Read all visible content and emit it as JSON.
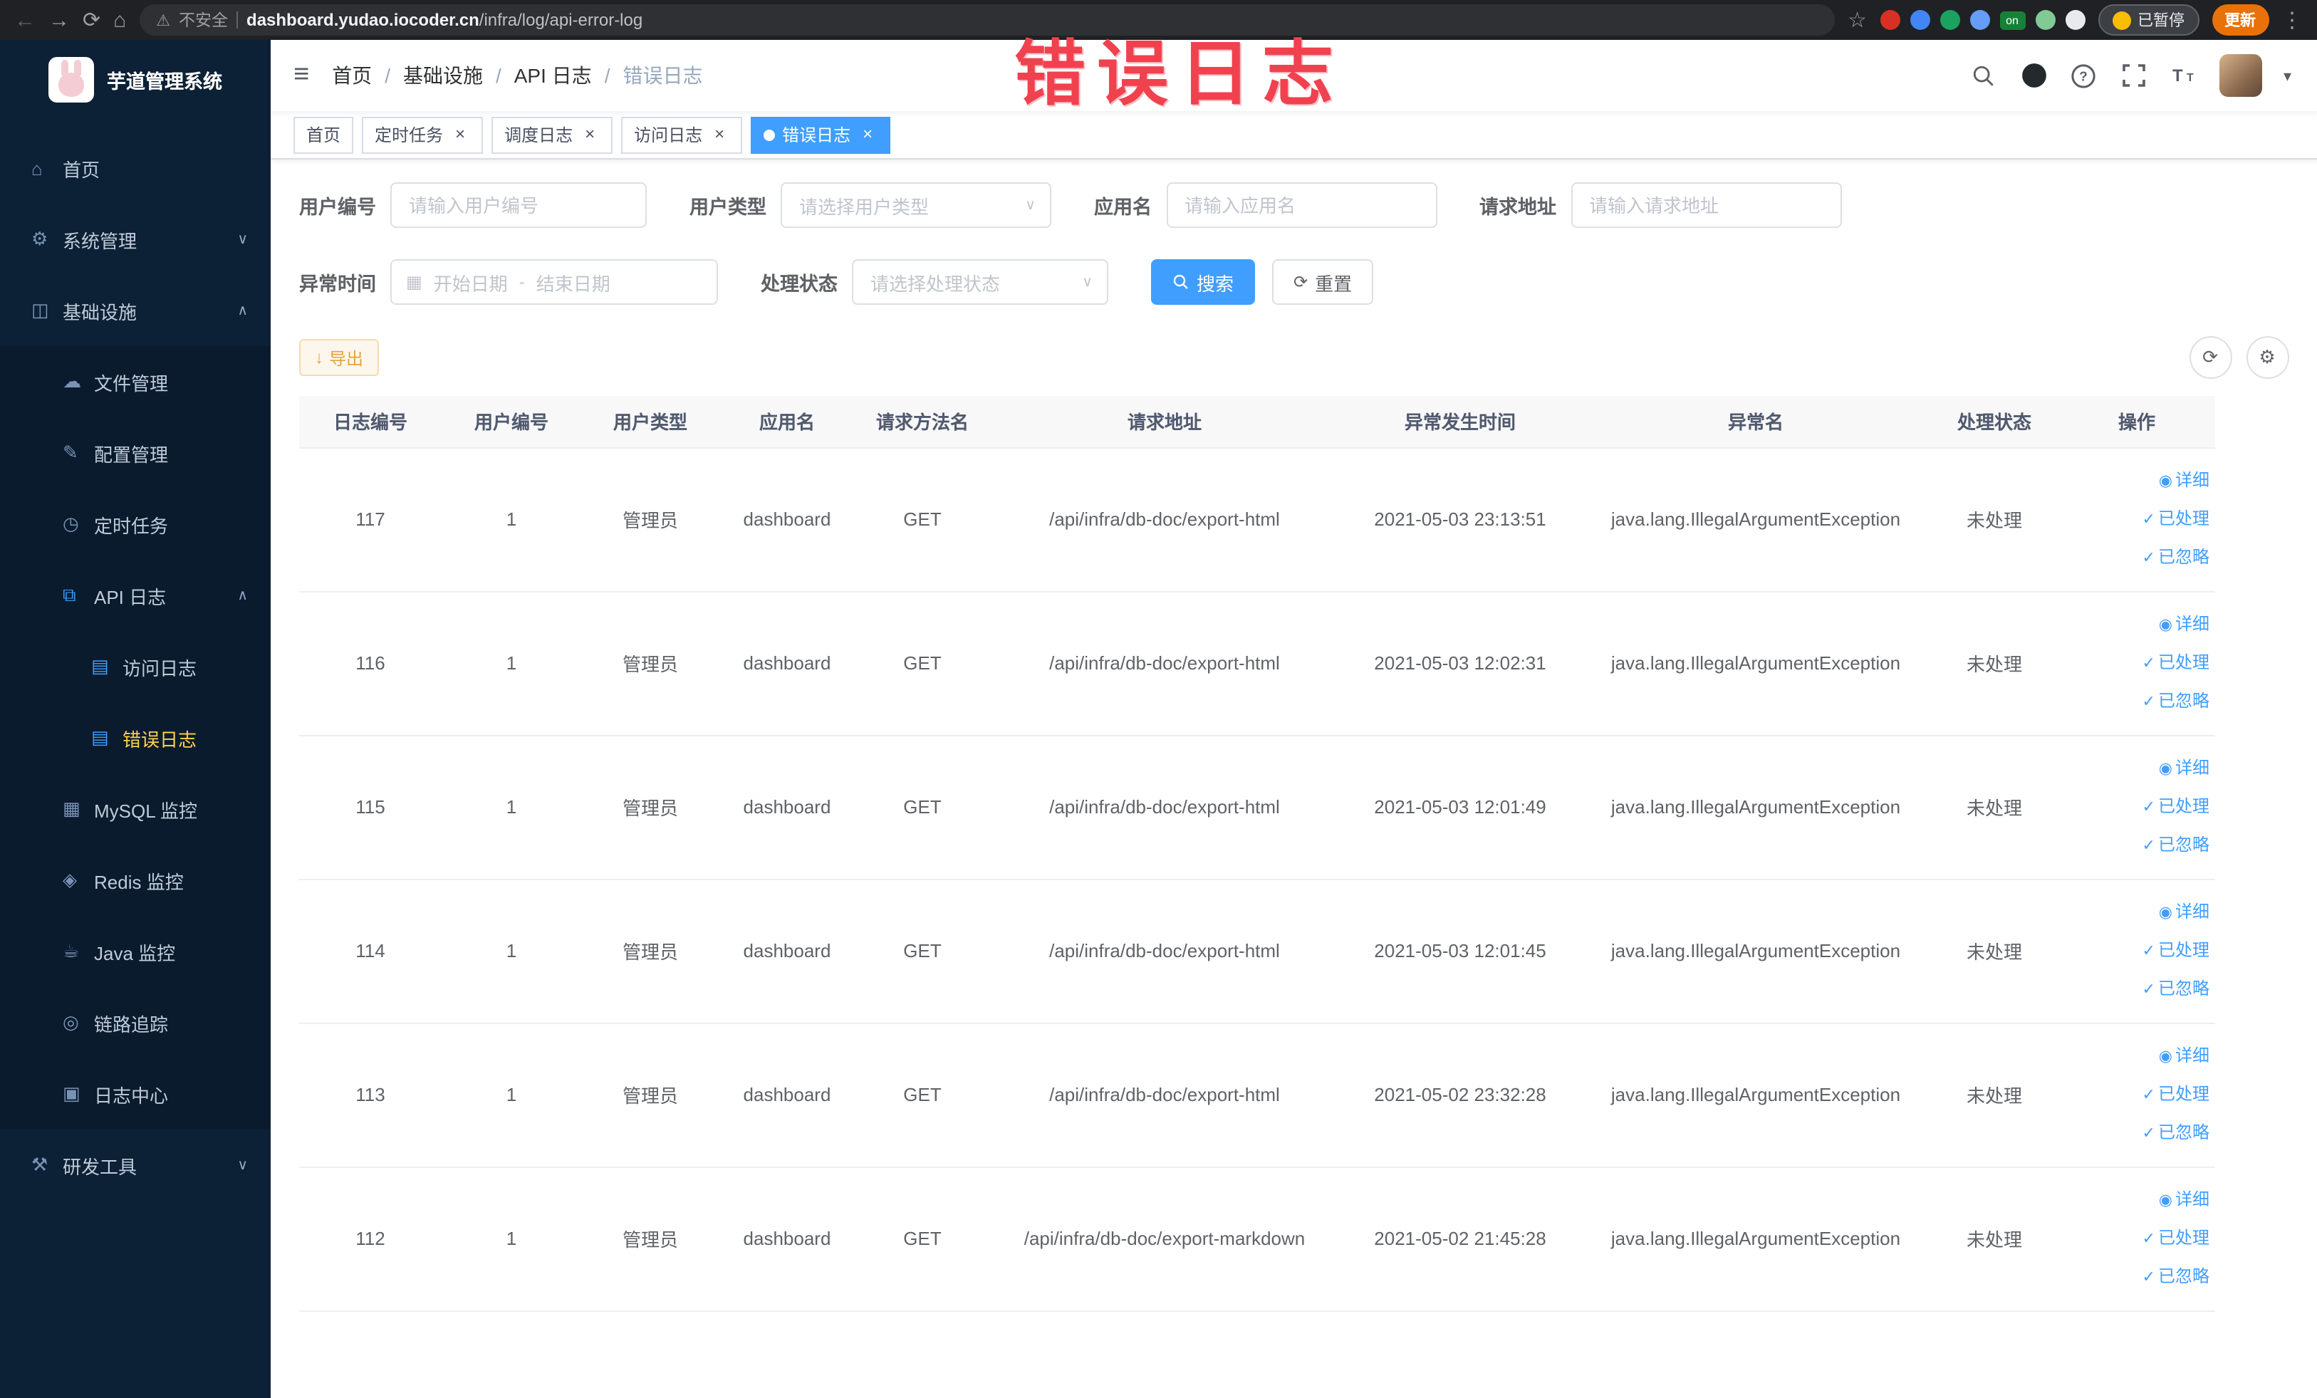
{
  "browser": {
    "security_label": "不安全",
    "url_host": "dashboard.yudao.iocoder.cn",
    "url_path": "/infra/log/api-error-log",
    "paused_label": "已暂停",
    "update_label": "更新",
    "extensions": [
      {
        "name": "extension-red-icon",
        "color": "#d93025"
      },
      {
        "name": "extension-blue-drop-icon",
        "color": "#4285f4"
      },
      {
        "name": "extension-green-circle-icon",
        "color": "#1aa260"
      },
      {
        "name": "extension-blue-grid-icon",
        "color": "#669df6"
      },
      {
        "name": "extension-on-badge",
        "color": "#188038",
        "label": "on"
      },
      {
        "name": "extension-leaf-icon",
        "color": "#81c995"
      },
      {
        "name": "extension-paw-icon",
        "color": "#e8eaed"
      }
    ]
  },
  "annotation": {
    "text": "错误日志",
    "color": "#f0414f"
  },
  "sidebar": {
    "logo_title": "芋道管理系统",
    "items": [
      {
        "name": "sidebar-item-home",
        "label": "首页",
        "icon": "home-icon",
        "level": 0,
        "chevron": null,
        "active": false,
        "in_open": false
      },
      {
        "name": "sidebar-item-system-management",
        "label": "系统管理",
        "icon": "gear-icon",
        "level": 0,
        "chevron": "down",
        "active": false,
        "in_open": false
      },
      {
        "name": "sidebar-item-infrastructure",
        "label": "基础设施",
        "icon": "monitor-icon",
        "level": 0,
        "chevron": "up",
        "active": false,
        "in_open": false
      },
      {
        "name": "sidebar-item-file-management",
        "label": "文件管理",
        "icon": "cloud-icon",
        "level": 1,
        "chevron": null,
        "active": false,
        "in_open": true
      },
      {
        "name": "sidebar-item-config-management",
        "label": "配置管理",
        "icon": "edit-icon",
        "level": 1,
        "chevron": null,
        "active": false,
        "in_open": true
      },
      {
        "name": "sidebar-item-scheduled-tasks",
        "label": "定时任务",
        "icon": "timer-icon",
        "level": 1,
        "chevron": null,
        "active": false,
        "in_open": true
      },
      {
        "name": "sidebar-item-api-logs",
        "label": "API 日志",
        "icon": "log-icon",
        "level": 1,
        "chevron": "up",
        "active": false,
        "in_open": true,
        "icon_color": "#409eff"
      },
      {
        "name": "sidebar-item-access-logs",
        "label": "访问日志",
        "icon": "doc-icon",
        "level": 2,
        "chevron": null,
        "active": false,
        "in_open": true,
        "icon_color": "#409eff"
      },
      {
        "name": "sidebar-item-error-logs",
        "label": "错误日志",
        "icon": "doc-icon",
        "level": 2,
        "chevron": null,
        "active": true,
        "in_open": true,
        "icon_color": "#409eff"
      },
      {
        "name": "sidebar-item-mysql-monitor",
        "label": "MySQL 监控",
        "icon": "database-icon",
        "level": 1,
        "chevron": null,
        "active": false,
        "in_open": true
      },
      {
        "name": "sidebar-item-redis-monitor",
        "label": "Redis 监控",
        "icon": "redis-icon",
        "level": 1,
        "chevron": null,
        "active": false,
        "in_open": true
      },
      {
        "name": "sidebar-item-java-monitor",
        "label": "Java 监控",
        "icon": "java-icon",
        "level": 1,
        "chevron": null,
        "active": false,
        "in_open": true
      },
      {
        "name": "sidebar-item-link-tracing",
        "label": "链路追踪",
        "icon": "trace-icon",
        "level": 1,
        "chevron": null,
        "active": false,
        "in_open": true
      },
      {
        "name": "sidebar-item-log-center",
        "label": "日志中心",
        "icon": "log-center-icon",
        "level": 1,
        "chevron": null,
        "active": false,
        "in_open": true
      },
      {
        "name": "sidebar-item-dev-tools",
        "label": "研发工具",
        "icon": "tools-icon",
        "level": 0,
        "chevron": "down",
        "active": false,
        "in_open": false
      }
    ]
  },
  "breadcrumb": {
    "items": [
      "首页",
      "基础设施",
      "API 日志",
      "错误日志"
    ],
    "separator": "/"
  },
  "tabs": [
    {
      "name": "tab-home",
      "label": "首页",
      "closable": false,
      "active": false
    },
    {
      "name": "tab-scheduled-tasks",
      "label": "定时任务",
      "closable": true,
      "active": false
    },
    {
      "name": "tab-schedule-logs",
      "label": "调度日志",
      "closable": true,
      "active": false
    },
    {
      "name": "tab-access-logs",
      "label": "访问日志",
      "closable": true,
      "active": false
    },
    {
      "name": "tab-error-logs",
      "label": "错误日志",
      "closable": true,
      "active": true
    }
  ],
  "filters": {
    "user_id": {
      "label": "用户编号",
      "placeholder": "请输入用户编号"
    },
    "user_type": {
      "label": "用户类型",
      "placeholder": "请选择用户类型"
    },
    "app_name": {
      "label": "应用名",
      "placeholder": "请输入应用名"
    },
    "request_url": {
      "label": "请求地址",
      "placeholder": "请输入请求地址"
    },
    "exception_time": {
      "label": "异常时间",
      "start_placeholder": "开始日期",
      "separator": "-",
      "end_placeholder": "结束日期"
    },
    "process_status": {
      "label": "处理状态",
      "placeholder": "请选择处理状态"
    },
    "search_label": "搜索",
    "reset_label": "重置"
  },
  "toolbar": {
    "export_label": "导出"
  },
  "table": {
    "headers": [
      "日志编号",
      "用户编号",
      "用户类型",
      "应用名",
      "请求方法名",
      "请求地址",
      "异常发生时间",
      "异常名",
      "处理状态",
      "操作"
    ],
    "actions": [
      "详细",
      "已处理",
      "已忽略"
    ],
    "rows": [
      {
        "log_id": "117",
        "user_id": "1",
        "user_type": "管理员",
        "app_name": "dashboard",
        "method": "GET",
        "url": "/api/infra/db-doc/export-html",
        "time": "2021-05-03 23:13:51",
        "exception": "java.lang.IllegalArgumentException",
        "status": "未处理"
      },
      {
        "log_id": "116",
        "user_id": "1",
        "user_type": "管理员",
        "app_name": "dashboard",
        "method": "GET",
        "url": "/api/infra/db-doc/export-html",
        "time": "2021-05-03 12:02:31",
        "exception": "java.lang.IllegalArgumentException",
        "status": "未处理"
      },
      {
        "log_id": "115",
        "user_id": "1",
        "user_type": "管理员",
        "app_name": "dashboard",
        "method": "GET",
        "url": "/api/infra/db-doc/export-html",
        "time": "2021-05-03 12:01:49",
        "exception": "java.lang.IllegalArgumentException",
        "status": "未处理"
      },
      {
        "log_id": "114",
        "user_id": "1",
        "user_type": "管理员",
        "app_name": "dashboard",
        "method": "GET",
        "url": "/api/infra/db-doc/export-html",
        "time": "2021-05-03 12:01:45",
        "exception": "java.lang.IllegalArgumentException",
        "status": "未处理"
      },
      {
        "log_id": "113",
        "user_id": "1",
        "user_type": "管理员",
        "app_name": "dashboard",
        "method": "GET",
        "url": "/api/infra/db-doc/export-html",
        "time": "2021-05-02 23:32:28",
        "exception": "java.lang.IllegalArgumentException",
        "status": "未处理"
      },
      {
        "log_id": "112",
        "user_id": "1",
        "user_type": "管理员",
        "app_name": "dashboard",
        "method": "GET",
        "url": "/api/infra/db-doc/export-markdown",
        "time": "2021-05-02 21:45:28",
        "exception": "java.lang.IllegalArgumentException",
        "status": "未处理"
      }
    ]
  }
}
